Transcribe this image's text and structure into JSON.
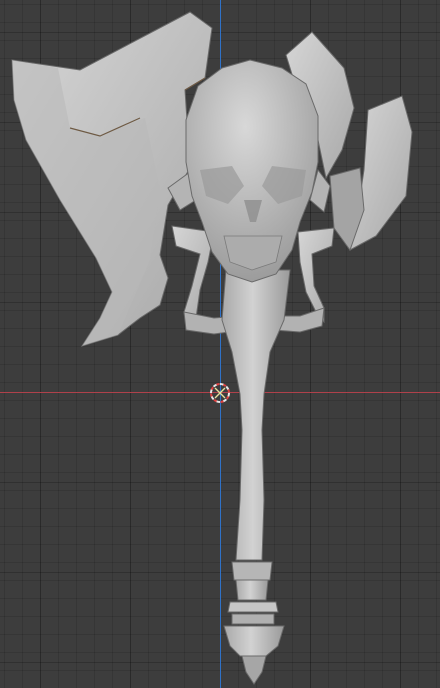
{
  "viewport": {
    "name": "3D viewport",
    "colors": {
      "background": "#3d3d3d",
      "grid": "#333333",
      "x_axis": "#b0414b",
      "y_axis": "#2f72c8",
      "mesh_light": "#c8c8c8",
      "mesh_shadow": "#8e8e8e",
      "cursor_red": "#e04040"
    },
    "icons": {
      "cursor": "3d-cursor-icon"
    },
    "objects": [
      {
        "name": "skull-mace-mesh",
        "kind": "mesh"
      }
    ]
  }
}
